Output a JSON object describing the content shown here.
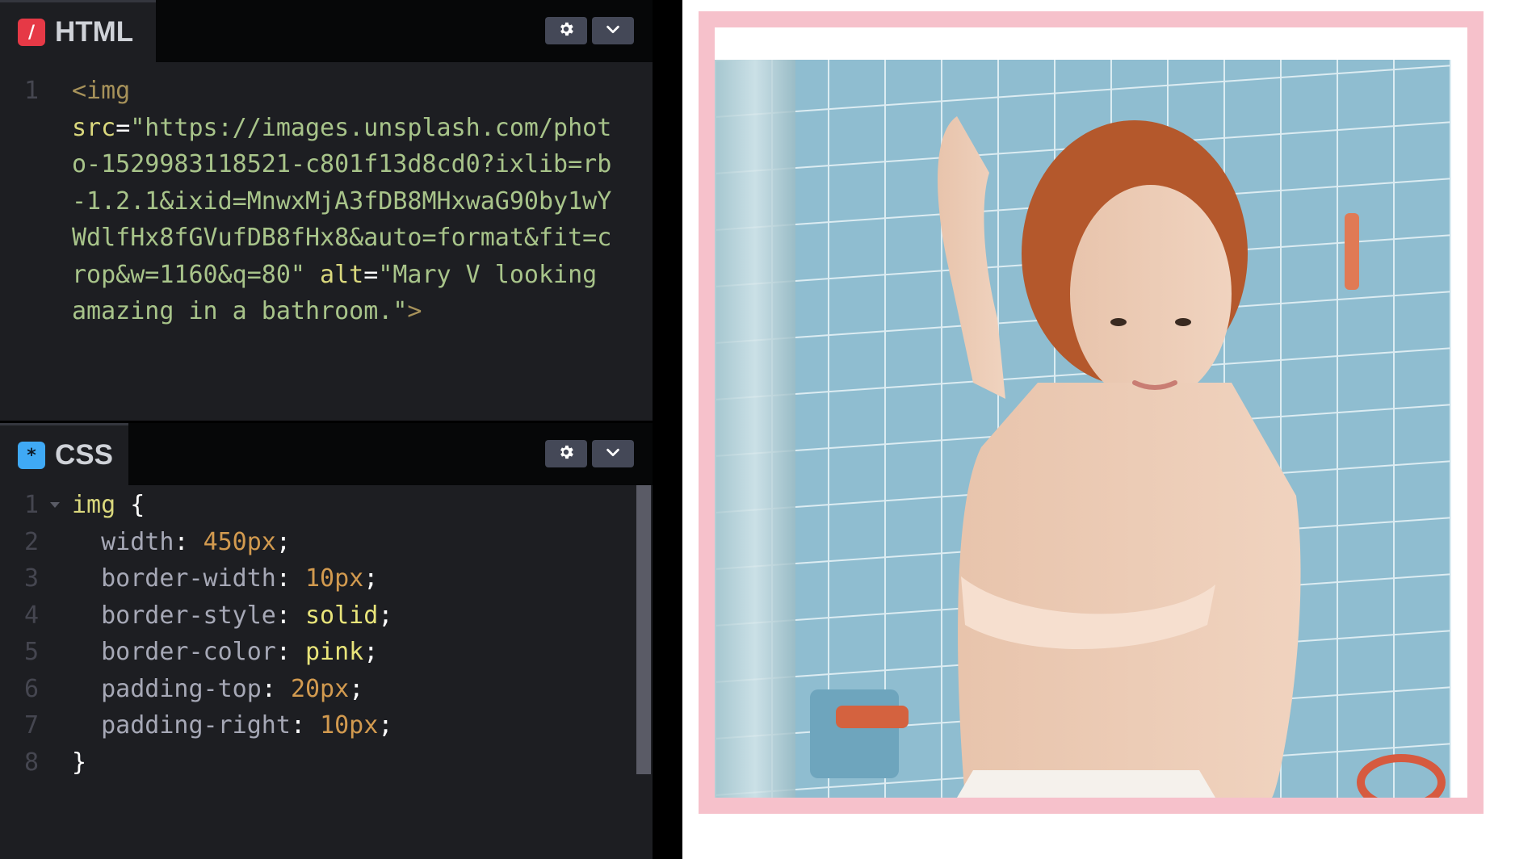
{
  "html_pane": {
    "tab_label": "HTML",
    "icon": "html-icon",
    "icon_glyph": "/",
    "icon_color": "#e63946",
    "settings_icon": "gear-icon",
    "collapse_icon": "chevron-down-icon",
    "lines": [
      {
        "num": "1",
        "parts": [
          "<img",
          "src",
          "=",
          "\"https://images.unsplash.com/photo-1529983118521-c801f13d8cd0?ixlib=rb-1.2.1&ixid=MnwxMjA3fDB8MHxwaG90by1wYWdlfHx8fGVufDB8fHx8&auto=format&fit=crop&w=1160&q=80\"",
          "alt",
          "=",
          "\"Mary V looking amazing in a bathroom.\"",
          ">"
        ]
      }
    ]
  },
  "css_pane": {
    "tab_label": "CSS",
    "icon": "css-icon",
    "icon_glyph": "*",
    "icon_color": "#3fa9f5",
    "settings_icon": "gear-icon",
    "collapse_icon": "chevron-down-icon",
    "lines": [
      {
        "num": "1",
        "selector": "img",
        "punc": " {"
      },
      {
        "num": "2",
        "prop": "width",
        "value": "450px"
      },
      {
        "num": "3",
        "prop": "border-width",
        "value": "10px"
      },
      {
        "num": "4",
        "prop": "border-style",
        "value": "solid"
      },
      {
        "num": "5",
        "prop": "border-color",
        "value": "pink"
      },
      {
        "num": "6",
        "prop": "padding-top",
        "value": "20px"
      },
      {
        "num": "7",
        "prop": "padding-right",
        "value": "10px"
      },
      {
        "num": "8",
        "close": "}"
      }
    ]
  },
  "preview": {
    "image_alt": "Mary V looking amazing in a bathroom.",
    "border_color": "#f6c1cb"
  }
}
